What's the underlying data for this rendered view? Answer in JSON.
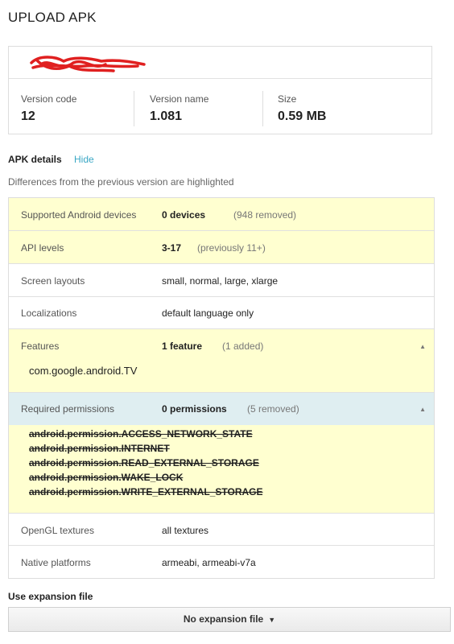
{
  "page_title": "UPLOAD APK",
  "version": {
    "code_label": "Version code",
    "code_value": "12",
    "name_label": "Version name",
    "name_value": "1.081",
    "size_label": "Size",
    "size_value": "0.59 MB"
  },
  "apk_details": {
    "title": "APK details",
    "hide_link": "Hide",
    "note": "Differences from the previous version are highlighted",
    "rows": {
      "devices": {
        "name": "Supported Android devices",
        "value": "0 devices",
        "note": "(948 removed)"
      },
      "api": {
        "name": "API levels",
        "value": "3-17",
        "note": "(previously 11+)"
      },
      "screens": {
        "name": "Screen layouts",
        "value": "small, normal, large, xlarge"
      },
      "locales": {
        "name": "Localizations",
        "value": "default language only"
      },
      "features": {
        "name": "Features",
        "value": "1 feature",
        "note": "(1 added)",
        "items": [
          "com.google.android.TV"
        ]
      },
      "permissions": {
        "name": "Required permissions",
        "value": "0 permissions",
        "note": "(5 removed)",
        "items": [
          "android.permission.ACCESS_NETWORK_STATE",
          "android.permission.INTERNET",
          "android.permission.READ_EXTERNAL_STORAGE",
          "android.permission.WAKE_LOCK",
          "android.permission.WRITE_EXTERNAL_STORAGE"
        ]
      },
      "opengl": {
        "name": "OpenGL textures",
        "value": "all textures"
      },
      "native": {
        "name": "Native platforms",
        "value": "armeabi, armeabi-v7a"
      }
    }
  },
  "expansion": {
    "title": "Use expansion file",
    "button_label": "No expansion file",
    "button_icon": "caret-down-icon"
  },
  "colors": {
    "highlight_yellow": "#ffffd0",
    "highlight_blue": "#dfeef1",
    "link": "#3aa7c5",
    "redaction": "#e02020"
  }
}
